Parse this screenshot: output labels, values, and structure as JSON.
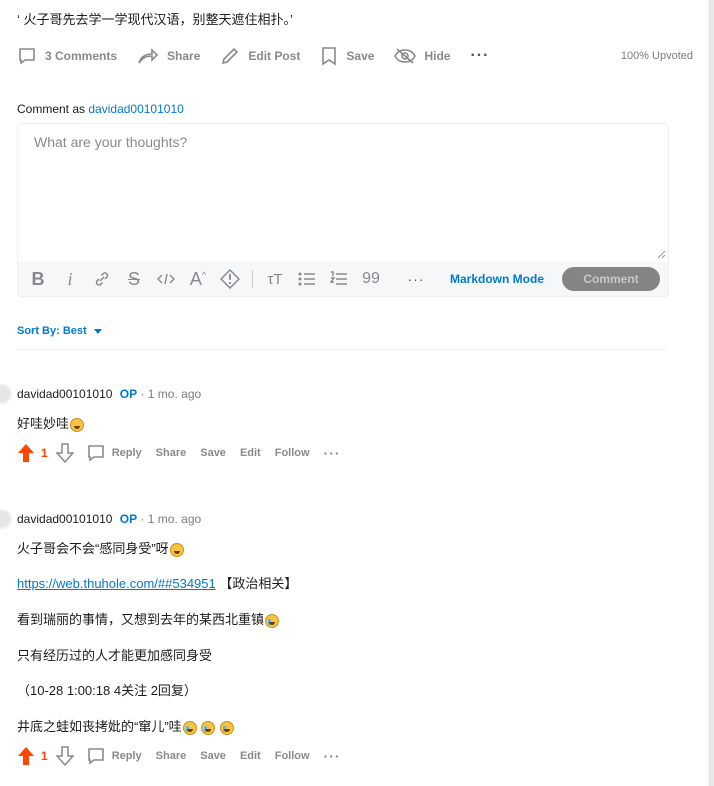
{
  "post": {
    "body": "‘ 火子哥先去学一学现代汉语，别整天遮住相扑。’",
    "actions": {
      "comments": "3 Comments",
      "share": "Share",
      "edit": "Edit Post",
      "save": "Save",
      "hide": "Hide",
      "more": "···"
    },
    "upvoted": "100% Upvoted"
  },
  "composer": {
    "comment_as_label": "Comment as",
    "username": "davidad00101010",
    "placeholder": "What are your thoughts?",
    "markdown_mode": "Markdown Mode",
    "submit": "Comment",
    "more": "···",
    "quote": "99"
  },
  "sort": {
    "label": "Sort By: Best"
  },
  "comments": [
    {
      "author": "davidad00101010",
      "op": "OP",
      "time": "· 1 mo. ago",
      "lines": [
        "好哇妙哇"
      ],
      "score": "1",
      "actions": {
        "reply": "Reply",
        "share": "Share",
        "save": "Save",
        "edit": "Edit",
        "follow": "Follow",
        "more": "···"
      }
    },
    {
      "author": "davidad00101010",
      "op": "OP",
      "time": "· 1 mo. ago",
      "line1": "火子哥会不会“感同身受”呀",
      "link": "https://web.thuhole.com/##534951",
      "link_suffix": "【政治相关】",
      "line3": "看到瑞丽的事情，又想到去年的某西北重镇",
      "line4": "只有经历过的人才能更加感同身受",
      "line5": "（10-28 1:00:18 4关注 2回复）",
      "line6": "井底之蛙如丧拷妣的“窜儿”哇",
      "score": "1",
      "actions": {
        "reply": "Reply",
        "share": "Share",
        "save": "Save",
        "edit": "Edit",
        "follow": "Follow",
        "more": "···"
      }
    }
  ],
  "colors": {
    "accent": "#0079d3",
    "upvote": "#ff4500",
    "muted": "#878a8c"
  }
}
